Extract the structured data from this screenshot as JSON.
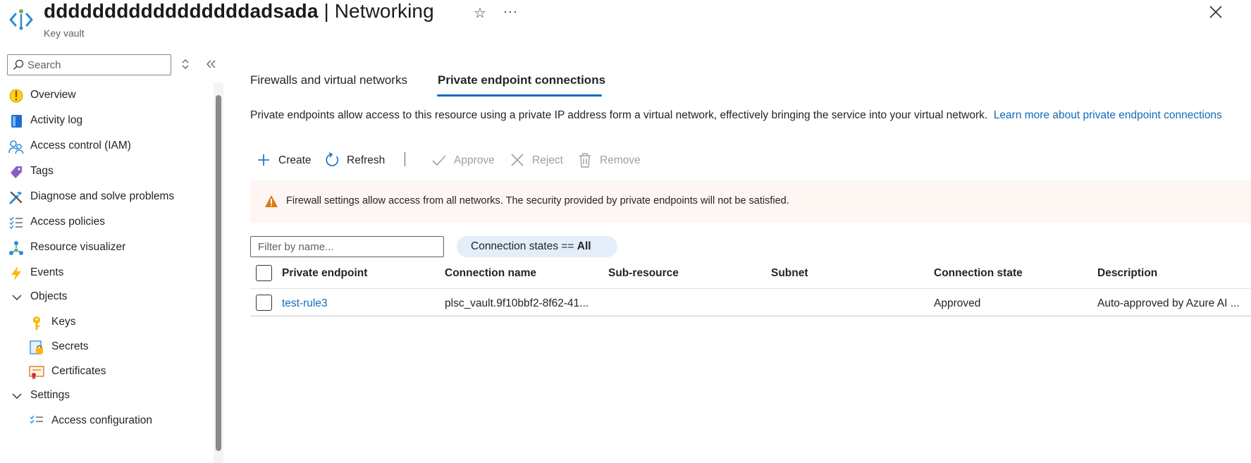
{
  "header": {
    "resource_name": "dddddddddddddddddadsada",
    "separator": " | ",
    "page": "Networking",
    "subtitle": "Key vault",
    "star_glyph": "☆",
    "more_glyph": "···"
  },
  "sidebar": {
    "search_placeholder": "Search",
    "items": [
      {
        "label": "Overview",
        "icon": "overview-icon"
      },
      {
        "label": "Activity log",
        "icon": "activity-log-icon"
      },
      {
        "label": "Access control (IAM)",
        "icon": "iam-icon"
      },
      {
        "label": "Tags",
        "icon": "tag-icon"
      },
      {
        "label": "Diagnose and solve problems",
        "icon": "wrench-icon"
      },
      {
        "label": "Access policies",
        "icon": "list-check-icon"
      },
      {
        "label": "Resource visualizer",
        "icon": "hierarchy-icon"
      },
      {
        "label": "Events",
        "icon": "bolt-icon"
      },
      {
        "label": "Objects",
        "icon": "chevron-down-icon"
      },
      {
        "label": "Keys",
        "icon": "key-icon"
      },
      {
        "label": "Secrets",
        "icon": "secret-icon"
      },
      {
        "label": "Certificates",
        "icon": "certificate-icon"
      },
      {
        "label": "Settings",
        "icon": "chevron-down-icon"
      },
      {
        "label": "Access configuration",
        "icon": "list-check-icon"
      }
    ]
  },
  "tabs": [
    {
      "label": "Firewalls and virtual networks",
      "active": false
    },
    {
      "label": "Private endpoint connections",
      "active": true
    }
  ],
  "description": {
    "text": "Private endpoints allow access to this resource using a private IP address form a virtual network, effectively bringing the service into your virtual network.",
    "link": "Learn more about private endpoint connections"
  },
  "toolbar": {
    "create": "Create",
    "refresh": "Refresh",
    "approve": "Approve",
    "reject": "Reject",
    "remove": "Remove"
  },
  "warning": {
    "text": "Firewall settings allow access from all networks. The security provided by private endpoints will not be satisfied."
  },
  "filter": {
    "placeholder": "Filter by name...",
    "pill_label": "Connection states == ",
    "pill_value": "All"
  },
  "table": {
    "columns": [
      "Private endpoint",
      "Connection name",
      "Sub-resource",
      "Subnet",
      "Connection state",
      "Description"
    ],
    "rows": [
      {
        "private_endpoint": "test-rule3",
        "connection_name": "plsc_vault.9f10bbf2-8f62-41...",
        "sub_resource": "",
        "subnet": "",
        "connection_state": "Approved",
        "description": "Auto-approved by Azure AI ..."
      }
    ]
  },
  "colors": {
    "accent": "#0f6cbd",
    "warning_bg": "#fdf6f3",
    "warning_icon": "#da7b11",
    "pill_bg": "#e4eefa"
  }
}
